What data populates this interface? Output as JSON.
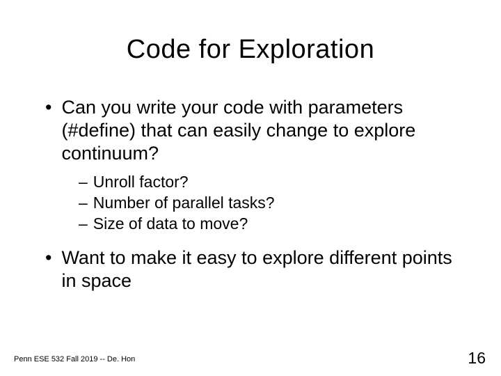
{
  "title": "Code for Exploration",
  "bullets": {
    "b1": "Can you write your code with parameters (#define) that can easily change to explore continuum?",
    "sub1": "Unroll factor?",
    "sub2": "Number of parallel tasks?",
    "sub3": "Size of data to move?",
    "b2": "Want to make it easy to explore different points in space"
  },
  "footer": "Penn ESE 532 Fall 2019 -- De. Hon",
  "page": "16"
}
